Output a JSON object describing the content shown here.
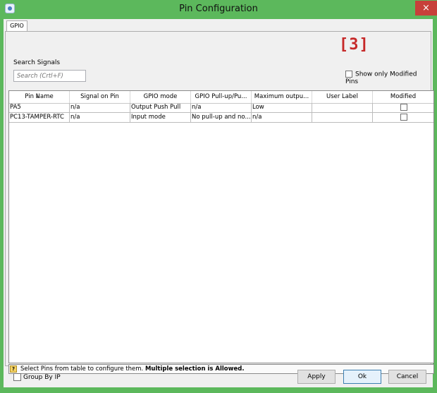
{
  "window": {
    "title": "Pin Configuration",
    "close_glyph": "×"
  },
  "tabs": [
    {
      "label": "GPIO"
    }
  ],
  "marker": "[3]",
  "search": {
    "label": "Search Signals",
    "placeholder": "Search (Crtl+F)"
  },
  "show_modified": {
    "label": "Show only Modified Pins",
    "checked": false
  },
  "table": {
    "columns": [
      "Pin Name",
      "Signal on Pin",
      "GPIO mode",
      "GPIO Pull-up/Pu...",
      "Maximum outpu...",
      "User Label",
      "Modified"
    ],
    "rows": [
      {
        "pin": "PA5",
        "signal": "n/a",
        "mode": "Output Push Pull",
        "pull": "n/a",
        "speed": "Low",
        "label": "",
        "modified": false
      },
      {
        "pin": "PC13-TAMPER-RTC",
        "signal": "n/a",
        "mode": "Input mode",
        "pull": "No pull-up and no...",
        "speed": "n/a",
        "label": "",
        "modified": false
      }
    ]
  },
  "hint": {
    "icon": "?",
    "text": "Select Pins from table to configure them.",
    "bold_text": "Multiple selection is Allowed."
  },
  "group_by": {
    "label": "Group By IP",
    "checked": false
  },
  "buttons": {
    "apply": "Apply",
    "ok": "Ok",
    "cancel": "Cancel"
  },
  "colors": {
    "frame": "#5cb85c",
    "close": "#c7403a",
    "marker": "#c62828"
  }
}
